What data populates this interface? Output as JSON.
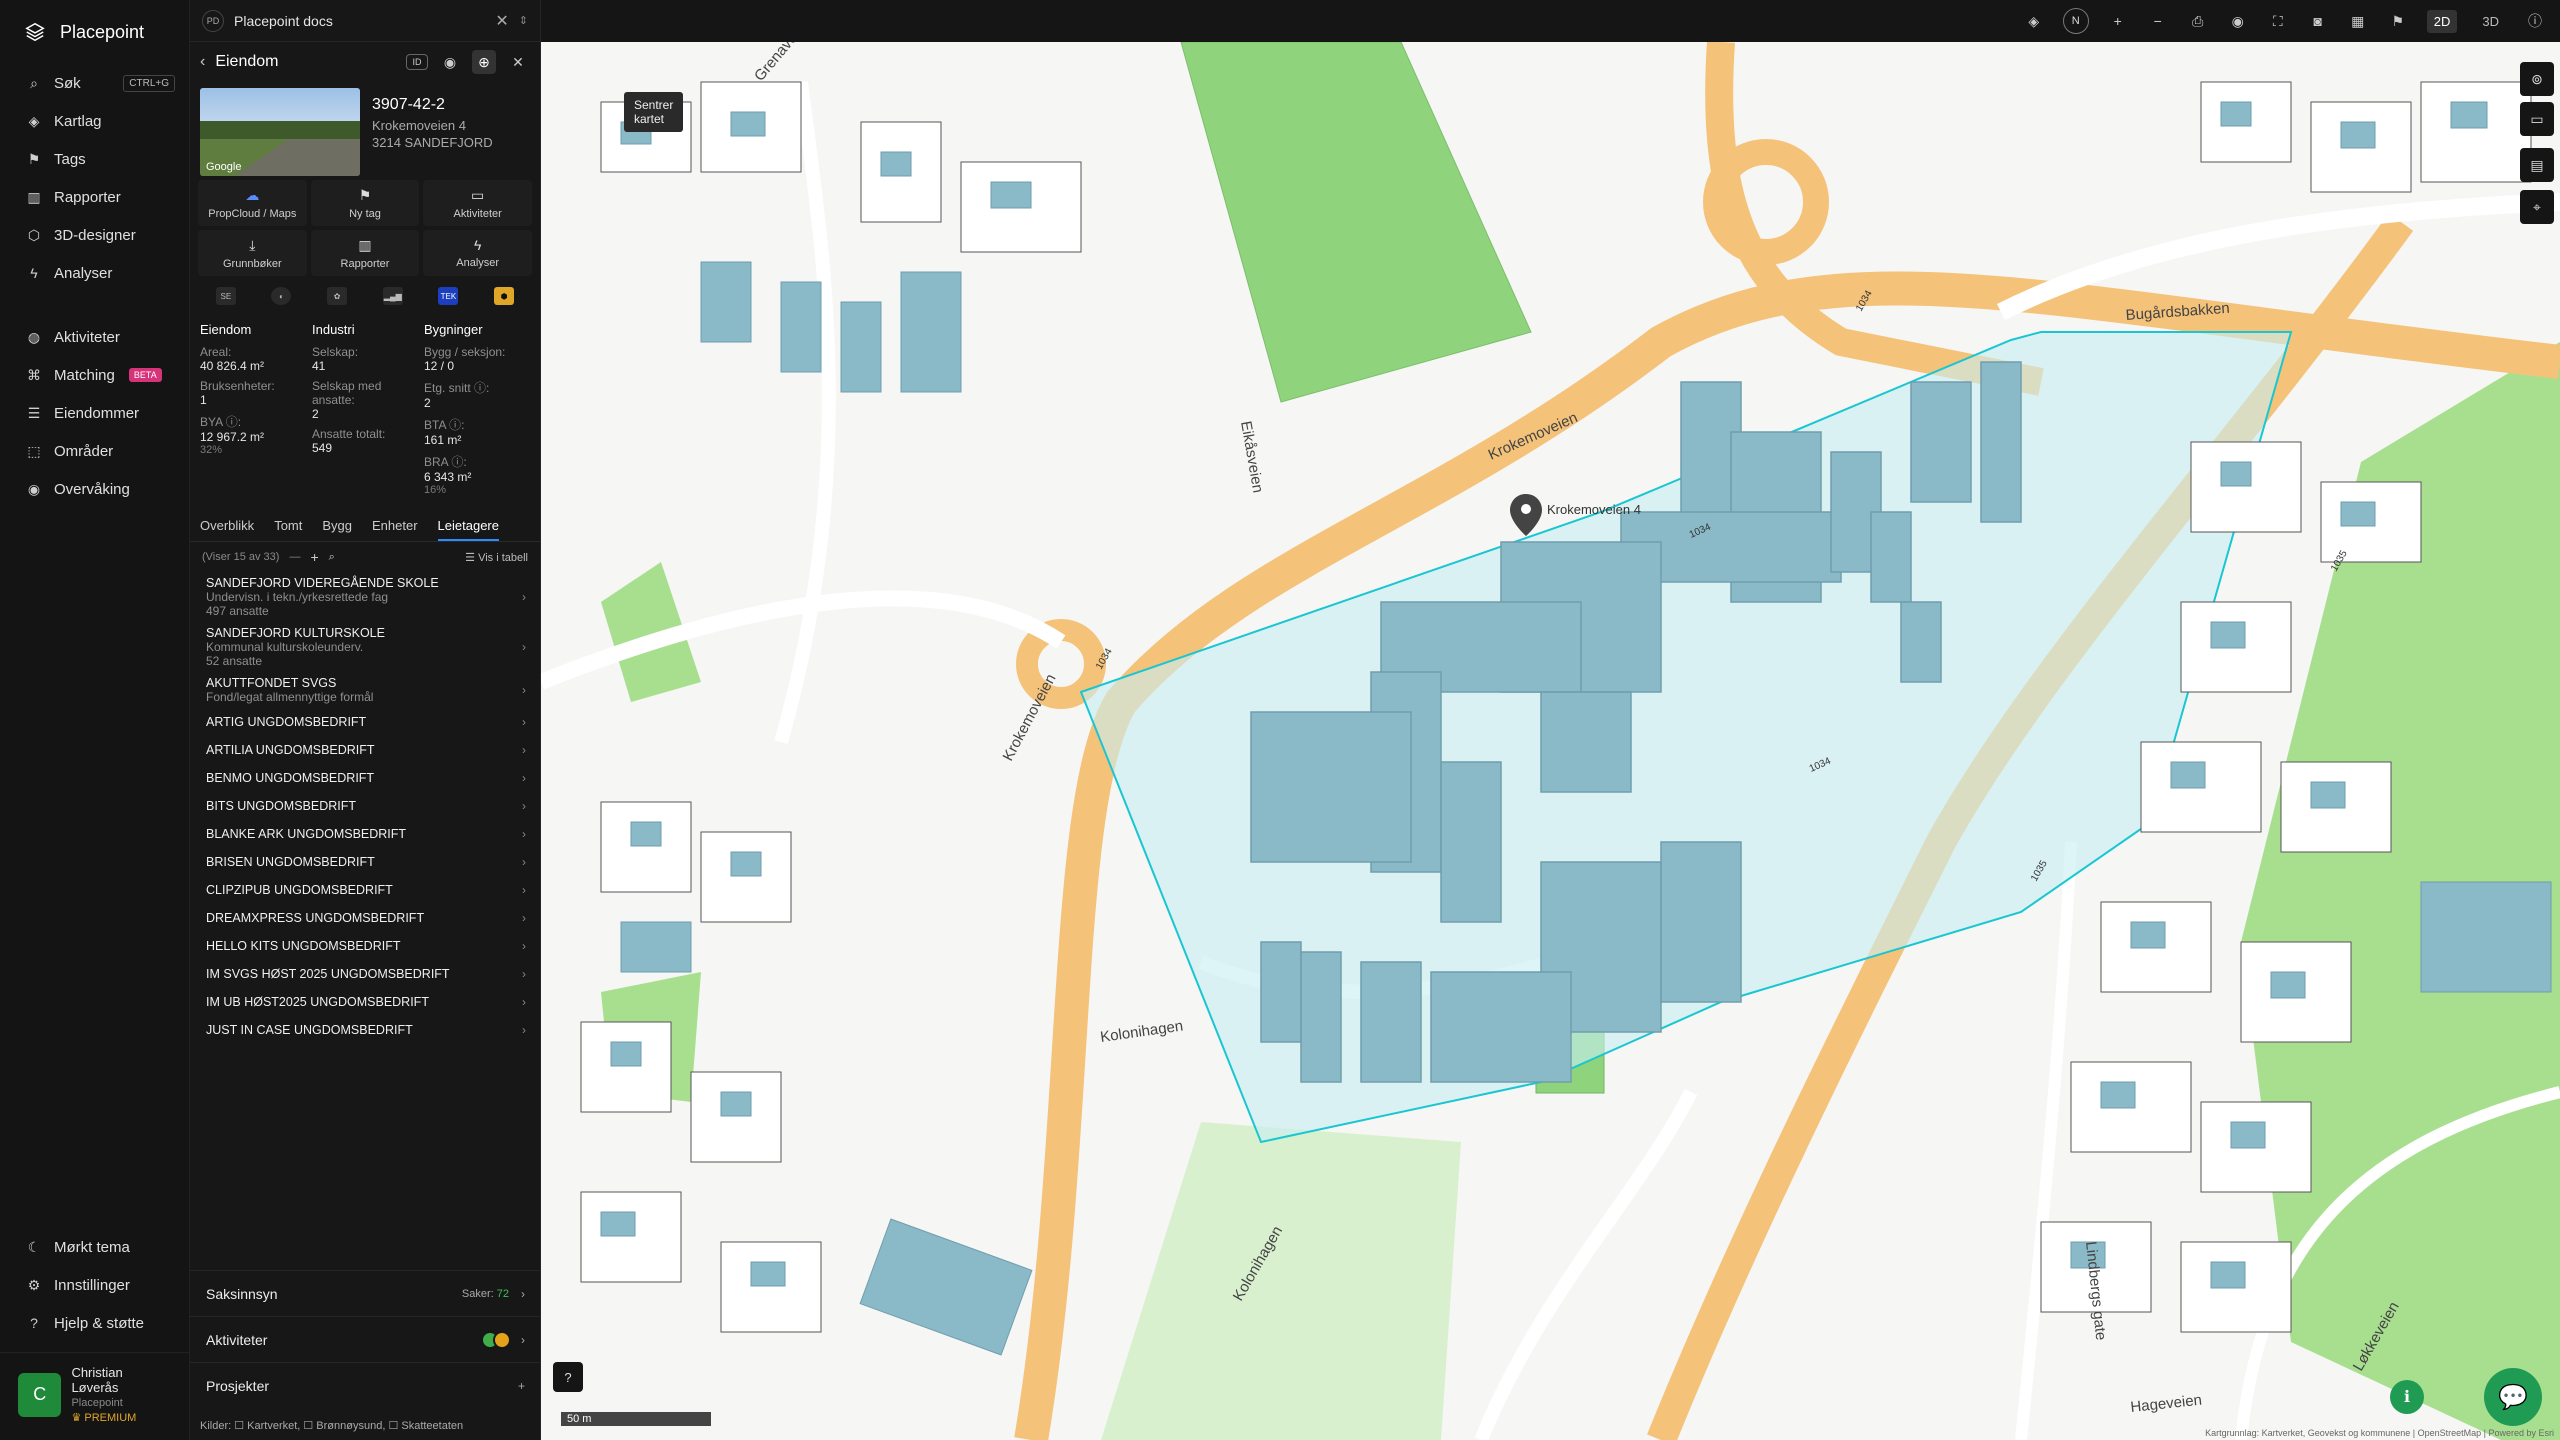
{
  "brand": "Placepoint",
  "nav": {
    "primary": [
      {
        "label": "Søk",
        "icon": "search-icon",
        "kbd": "CTRL+G"
      },
      {
        "label": "Kartlag",
        "icon": "layers-icon"
      },
      {
        "label": "Tags",
        "icon": "bookmark-icon"
      },
      {
        "label": "Rapporter",
        "icon": "chart-icon"
      },
      {
        "label": "3D-designer",
        "icon": "cube-icon"
      },
      {
        "label": "Analyser",
        "icon": "bolt-icon"
      }
    ],
    "secondary": [
      {
        "label": "Aktiviteter",
        "icon": "activity-icon"
      },
      {
        "label": "Matching",
        "icon": "matching-icon",
        "badge": "BETA"
      },
      {
        "label": "Eiendommer",
        "icon": "list-icon"
      },
      {
        "label": "Områder",
        "icon": "area-icon"
      },
      {
        "label": "Overvåking",
        "icon": "eye-icon"
      }
    ],
    "bottom": [
      {
        "label": "Mørkt tema",
        "icon": "moon-icon"
      },
      {
        "label": "Innstillinger",
        "icon": "gear-icon"
      },
      {
        "label": "Hjelp & støtte",
        "icon": "help-icon"
      }
    ],
    "user": {
      "initial": "C",
      "name": "Christian Løverås",
      "org": "Placepoint",
      "plan": "PREMIUM"
    }
  },
  "panel": {
    "doc_badge": "PD",
    "doc_title": "Placepoint docs",
    "header_title": "Eiendom",
    "tooltip": "Sentrer kartet",
    "prop_id": "3907-42-2",
    "prop_address": "Krokemoveien 4",
    "prop_city": "3214 SANDEFJORD",
    "thumb_label": "Google",
    "actions": [
      {
        "label": "PropCloud / Maps",
        "icon": "cloud-icon"
      },
      {
        "label": "Ny tag",
        "icon": "bookmark-icon"
      },
      {
        "label": "Aktiviteter",
        "icon": "chat-icon"
      },
      {
        "label": "Grunnbøker",
        "icon": "download-icon"
      },
      {
        "label": "Rapporter",
        "icon": "chart-icon"
      },
      {
        "label": "Analyser",
        "icon": "bolt-icon"
      }
    ],
    "stats": {
      "eiendom": {
        "title": "Eiendom",
        "areal_label": "Areal:",
        "areal": "40 826.4 m²",
        "bruk_label": "Bruksenheter:",
        "bruk": "1",
        "bya_label": "BYA ⓘ:",
        "bya": "12 967.2 m²",
        "bya_pct": "32%"
      },
      "industri": {
        "title": "Industri",
        "selskap_label": "Selskap:",
        "selskap": "41",
        "ansatte_label": "Selskap med ansatte:",
        "ansatte": "2",
        "totalt_label": "Ansatte totalt:",
        "totalt": "549"
      },
      "bygninger": {
        "title": "Bygninger",
        "bygg_label": "Bygg / seksjon:",
        "bygg": "12 / 0",
        "etg_label": "Etg. snitt ⓘ:",
        "etg": "2",
        "bta_label": "BTA ⓘ:",
        "bta": "161 m²",
        "bra_label": "BRA ⓘ:",
        "bra": "6 343 m²",
        "bra_pct": "16%"
      }
    },
    "tabs": [
      "Overblikk",
      "Tomt",
      "Bygg",
      "Enheter",
      "Leietagere"
    ],
    "active_tab": "Leietagere",
    "list_count": "(Viser 15 av 33)",
    "table_toggle": "Vis i tabell",
    "tenants": [
      {
        "name": "SANDEFJORD VIDEREGÅENDE SKOLE",
        "sub1": "Undervisn. i tekn./yrkesrettede fag",
        "sub2": "497 ansatte"
      },
      {
        "name": "SANDEFJORD KULTURSKOLE",
        "sub1": "Kommunal kulturskoleunderv.",
        "sub2": "52 ansatte"
      },
      {
        "name": "AKUTTFONDET SVGS",
        "sub1": "Fond/legat allmennyttige formål",
        "sub2": ""
      },
      {
        "name": "ARTIG UNGDOMSBEDRIFT",
        "sub1": "",
        "sub2": ""
      },
      {
        "name": "ARTILIA UNGDOMSBEDRIFT",
        "sub1": "",
        "sub2": ""
      },
      {
        "name": "BENMO UNGDOMSBEDRIFT",
        "sub1": "",
        "sub2": ""
      },
      {
        "name": "BITS UNGDOMSBEDRIFT",
        "sub1": "",
        "sub2": ""
      },
      {
        "name": "BLANKE ARK UNGDOMSBEDRIFT",
        "sub1": "",
        "sub2": ""
      },
      {
        "name": "BRISEN UNGDOMSBEDRIFT",
        "sub1": "",
        "sub2": ""
      },
      {
        "name": "CLIPZIPUB UNGDOMSBEDRIFT",
        "sub1": "",
        "sub2": ""
      },
      {
        "name": "DREAMXPRESS UNGDOMSBEDRIFT",
        "sub1": "",
        "sub2": ""
      },
      {
        "name": "HELLO KITS UNGDOMSBEDRIFT",
        "sub1": "",
        "sub2": ""
      },
      {
        "name": "IM SVGS HØST 2025 UNGDOMSBEDRIFT",
        "sub1": "",
        "sub2": ""
      },
      {
        "name": "IM UB HØST2025 UNGDOMSBEDRIFT",
        "sub1": "",
        "sub2": ""
      },
      {
        "name": "JUST IN CASE UNGDOMSBEDRIFT",
        "sub1": "",
        "sub2": ""
      }
    ],
    "saksinnsyn": {
      "label": "Saksinnsyn",
      "sak_label": "Saker:",
      "sak_count": "72"
    },
    "aktiviteter": "Aktiviteter",
    "prosjekter": "Prosjekter",
    "kilder": "Kilder: ☐ Kartverket, ☐ Brønnøysund, ☐ Skatteetaten"
  },
  "map": {
    "north": "N",
    "dim2d": "2D",
    "dim3d": "3D",
    "scale": "50 m",
    "attribution": "Kartgrunnlag: Kartverket, Geovekst og kommunene | OpenStreetMap | Powered by Esri",
    "street_labels": [
      "Krokemoveien",
      "Krokemoveien",
      "Bugårdsbakken",
      "Kolonihagen",
      "Kolonihagen",
      "Eikåsveien",
      "Lindbergs gate",
      "Hageveien",
      "Løkkeveien",
      "Grenaveien"
    ],
    "road_codes": [
      "1034",
      "1034",
      "1034",
      "1034",
      "1035",
      "1035"
    ],
    "marker_label": "Krokemoveien 4",
    "colors": {
      "selection": "#19c6d1",
      "buildings": "#8ab9c8",
      "grass": "#8fd47d",
      "road": "#f5c27a"
    }
  }
}
